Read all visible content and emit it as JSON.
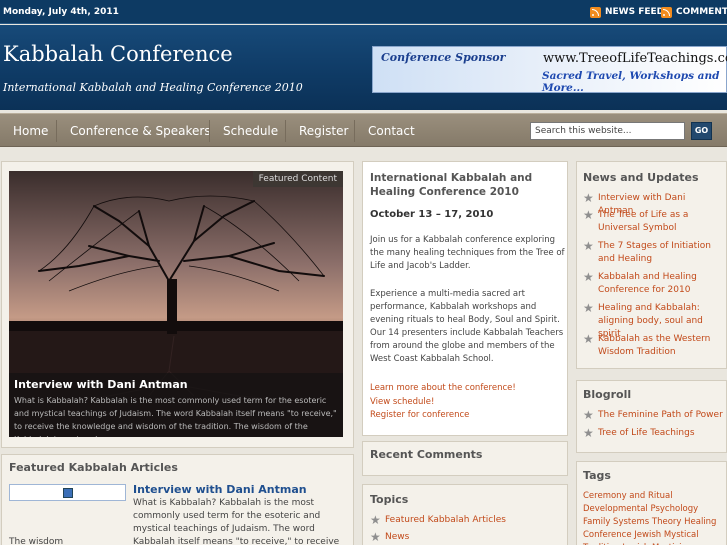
{
  "topbar": {
    "date": "Monday, July 4th, 2011",
    "news_feed": "NEWS FEED",
    "comments": "COMMENTS"
  },
  "header": {
    "title": "Kabbalah Conference",
    "description": "International Kabbalah and Healing Conference 2010",
    "sponsor": {
      "label": "Conference Sponsor",
      "url_text": "www.TreeofLifeTeachings.com",
      "tagline": "Sacred Travel, Workshops and More..."
    }
  },
  "nav": {
    "items": [
      "Home",
      "Conference & Speakers",
      "Schedule",
      "Register",
      "Contact"
    ],
    "search_placeholder": "Search this website...",
    "go_label": "GO"
  },
  "featured": {
    "label": "Featured Content",
    "title": "Interview with Dani Antman",
    "text": "What is Kabbalah? Kabbalah is the most commonly used term for the esoteric and mystical teachings of Judaism.  The word Kabbalah itself means \"to receive,\" to receive the knowledge and wisdom of the tradition.  The wisdom of the Kabbalah is vast and"
  },
  "articles": {
    "heading": "Featured Kabbalah Articles",
    "title": "Interview with Dani Antman",
    "text": "What is Kabbalah? Kabbalah is the most commonly used term for the esoteric and mystical teachings of Judaism. The word Kabbalah itself means \"to receive,\" to receive the knowledge and wisdom of the tradition.",
    "text_tail": "The wisdom"
  },
  "conference": {
    "title": "International Kabbalah and Healing Conference 2010",
    "date": "October 13 – 17, 2010",
    "p1": "Join us for a Kabbalah conference exploring the many healing techniques from the Tree of Life and Jacob's Ladder.",
    "p2": "Experience a multi-media sacred art performance, Kabbalah workshops and evening rituals to heal Body, Soul and Spirit. Our 14 presenters include Kabbalah Teachers from around the globe and members of the West Coast Kabbalah School.",
    "links": [
      "Learn more about the conference!",
      "View schedule!",
      "Register for conference"
    ]
  },
  "recent_comments": {
    "heading": "Recent Comments"
  },
  "topics": {
    "heading": "Topics",
    "items": [
      "Featured Kabbalah Articles",
      "News"
    ]
  },
  "news": {
    "heading": "News and Updates",
    "items": [
      "Interview with Dani Antman",
      "The Tree of Life as a Universal Symbol",
      "The 7 Stages of Initiation and Healing",
      "Kabbalah and Healing Conference for 2010",
      "Healing and Kabbalah: aligning body, soul and spirit",
      "Kabbalah as the Western Wisdom Tradition"
    ]
  },
  "blogroll": {
    "heading": "Blogroll",
    "items": [
      "The Feminine Path of Power",
      "Tree of Life Teachings"
    ]
  },
  "tags": {
    "heading": "Tags",
    "text": "Ceremony and Ritual Developmental Psychology Family Systems Theory Healing Conference Jewish Mystical Tradition Jewish Mysticism"
  },
  "colors": {
    "link": "#c24a1a",
    "header_bg": "#0f3b66",
    "nav_bg": "#8b806e"
  },
  "icons": [
    "rss-icon",
    "star-icon",
    "tree-photo"
  ]
}
